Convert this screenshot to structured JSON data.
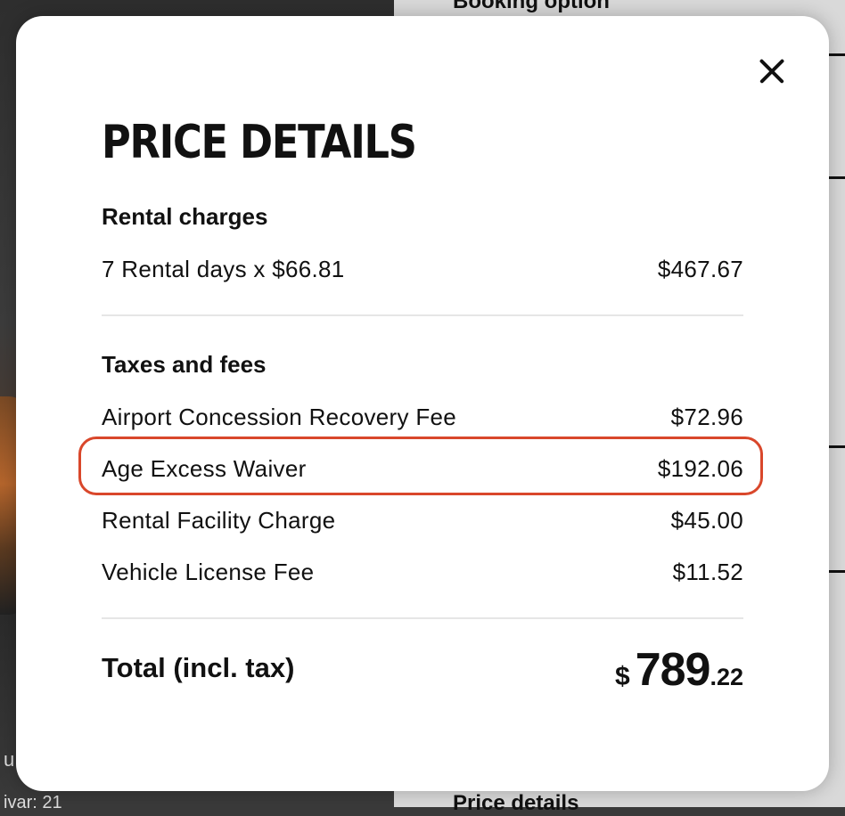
{
  "background": {
    "top_right_heading": "Booking option",
    "bottom_right_heading": "Price details",
    "left_partial_text_1": "u",
    "left_partial_text_2": "ivar: 21"
  },
  "modal": {
    "title": "PRICE DETAILS",
    "close_icon": "close-icon",
    "sections": [
      {
        "heading": "Rental charges",
        "rows": [
          {
            "label": "7 Rental days x $66.81",
            "amount": "$467.67"
          }
        ]
      },
      {
        "heading": "Taxes and fees",
        "rows": [
          {
            "label": "Airport Concession Recovery Fee",
            "amount": "$72.96"
          },
          {
            "label": "Age Excess Waiver",
            "amount": "$192.06"
          },
          {
            "label": "Rental Facility Charge",
            "amount": "$45.00"
          },
          {
            "label": "Vehicle License Fee",
            "amount": "$11.52"
          }
        ]
      }
    ],
    "total": {
      "label": "Total (incl. tax)",
      "currency": "$",
      "whole": "789",
      "decimal": ".22"
    },
    "highlight_color": "#d9472b"
  }
}
